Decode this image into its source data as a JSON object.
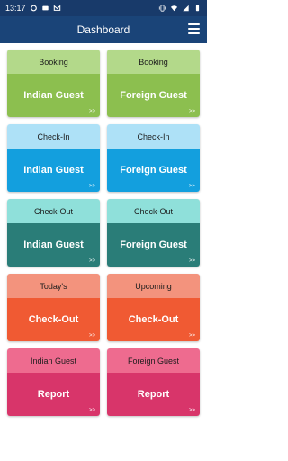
{
  "status_bar": {
    "time": "13:17",
    "left_icons": [
      "ring-icon",
      "image-icon",
      "gmail-icon"
    ],
    "right_icons": [
      "vibrate-icon",
      "wifi-icon",
      "signal-icon",
      "battery-icon"
    ]
  },
  "app_bar": {
    "title": "Dashboard",
    "menu_icon": "hamburger-menu-icon"
  },
  "tiles": [
    {
      "header": "Booking",
      "label": "Indian Guest",
      "arrow": ">>",
      "theme": "green"
    },
    {
      "header": "Booking",
      "label": "Foreign Guest",
      "arrow": ">>",
      "theme": "green"
    },
    {
      "header": "Check-In",
      "label": "Indian Guest",
      "arrow": ">>",
      "theme": "blue"
    },
    {
      "header": "Check-In",
      "label": "Foreign Guest",
      "arrow": ">>",
      "theme": "blue"
    },
    {
      "header": "Check-Out",
      "label": "Indian Guest",
      "arrow": ">>",
      "theme": "teal"
    },
    {
      "header": "Check-Out",
      "label": "Foreign Guest",
      "arrow": ">>",
      "theme": "teal"
    },
    {
      "header": "Today's",
      "label": "Check-Out",
      "arrow": ">>",
      "theme": "orange"
    },
    {
      "header": "Upcoming",
      "label": "Check-Out",
      "arrow": ">>",
      "theme": "orange"
    },
    {
      "header": "Indian Guest",
      "label": "Report",
      "arrow": ">>",
      "theme": "pink"
    },
    {
      "header": "Foreign Guest",
      "label": "Report",
      "arrow": ">>",
      "theme": "pink"
    }
  ],
  "colors": {
    "status_bar": "#183a6a",
    "app_bar": "#1a4478",
    "green": "#8cbf4f",
    "blue": "#139fde",
    "teal": "#2a7d78",
    "orange": "#f05a33",
    "pink": "#d8356a"
  }
}
